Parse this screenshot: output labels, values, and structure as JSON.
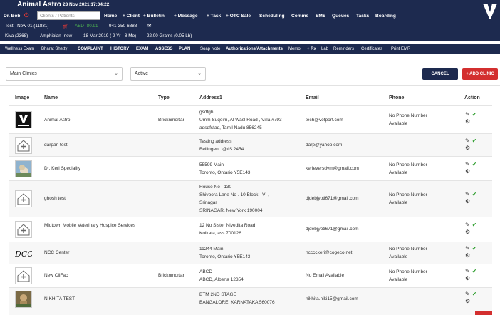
{
  "header": {
    "brand": "Animal Astro",
    "datetime": "23 Nov 2021 17:04:22",
    "user": "Dr. Bob",
    "search_placeholder": "Clients / Patients",
    "nav": [
      "Home",
      "+ Client",
      "+ Bulletin",
      "+ Message",
      "+ Task",
      "+ OTC Sale",
      "Scheduling",
      "Comms",
      "SMS",
      "Queues",
      "Tasks",
      "Boarding"
    ]
  },
  "client_bar": {
    "client": "Test - New 01 (11831)",
    "balance": "AED -80.91",
    "phone": "941-350-6888"
  },
  "patient_bar": {
    "patient": "Kiva (2368)",
    "species": "Amphibian -new",
    "dob": "18 Mar 2019 ( 2 Yr - 8 Mo)",
    "weight": "22.00 Grams (0.05 Lb)"
  },
  "exam_bar": {
    "exam": "Wellness Exam",
    "doctor": "Bharat Shetty",
    "tabs": [
      "COMPLAINT",
      "HISTORY",
      "EXAM",
      "ASSESS",
      "PLAN",
      "Soap Note",
      "Authorizations/Attachments",
      "Memo",
      "+ Rx",
      "Lab",
      "Reminders",
      "Certificates",
      "Print EMR"
    ]
  },
  "filters": {
    "clinic_select": "Main Clinics",
    "status_select": "Active",
    "cancel_label": "CANCEL",
    "add_label": "+ ADD CLINIC"
  },
  "table": {
    "columns": [
      "Image",
      "Name",
      "Type",
      "Address1",
      "Email",
      "Phone",
      "Action"
    ],
    "rows": [
      {
        "name": "Animal Astro",
        "type": "Bricknmortar",
        "address": [
          "gsdfgh",
          "Umm Suqeim, Al Wasl Road , Villa #793",
          "adsdfsfad, Tamil Nadu 856245"
        ],
        "email": "tech@vetport.com",
        "phone": [
          "No Phone Number",
          "Available"
        ],
        "image": "vetport-logo"
      },
      {
        "name": "darpan test",
        "type": "",
        "address": [
          "Testing address",
          "Bellingen, !@#$ 2454"
        ],
        "email": "darp@yahoo.com",
        "phone": [],
        "image": "clinic-placeholder-icon"
      },
      {
        "name": "Dr. Keri Speciality",
        "type": "",
        "address": [
          "55599 Main",
          "Toronto, Ontario Y5E143"
        ],
        "email": "kerieversdvm@gmail.com",
        "phone": [
          "No Phone Number",
          "Available"
        ],
        "image": "clinic-photo"
      },
      {
        "name": "ghosh test",
        "type": "",
        "address": [
          "House No , 130",
          "Shivpora Lane No . 10,Block - VI ,",
          "Srinagar",
          "SRINAGAR, New York 190004"
        ],
        "email": "djdebjyoti671@gmail.com",
        "phone": [
          "No Phone Number",
          "Available"
        ],
        "image": "clinic-placeholder-icon"
      },
      {
        "name": "Midtown Mobile Veterinary Hospice Services",
        "type": "",
        "address": [
          "12 No Sister Nivedita Road",
          "Kolkata, ass 700126"
        ],
        "email": "djdebjyoti671@gmail.com",
        "phone": [],
        "image": "clinic-placeholder-icon"
      },
      {
        "name": "NCC Center",
        "type": "",
        "address": [
          "11244 Main",
          "Toronto, Ontario Y5E143"
        ],
        "email": "ncccckeri@cogeco.net",
        "phone": [
          "No Phone Number",
          "Available"
        ],
        "image": "dccc-logo"
      },
      {
        "name": "New CliFac",
        "type": "Bricknmortar",
        "address": [
          "ABCD",
          "ABCD, Alberta 12354"
        ],
        "email": "No Email Available",
        "phone": [
          "No Phone Number",
          "Available"
        ],
        "image": "clinic-placeholder-icon"
      },
      {
        "name": "NIKHITA TEST",
        "type": "",
        "address": [
          "BTM 2ND STAGE",
          "BANGALORE, KARNATAKA 560076"
        ],
        "email": "nikhita.niki15@gmail.com",
        "phone": [],
        "image": "clinic-photo"
      }
    ]
  },
  "colors": {
    "navbar": "#1d2a4f",
    "accent_red": "#d32f2f",
    "check_green": "#2e9e2e"
  }
}
